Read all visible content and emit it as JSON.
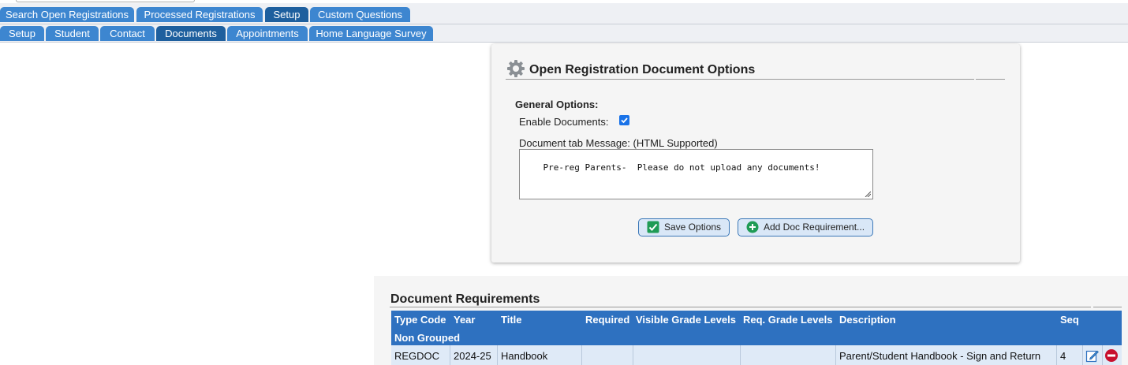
{
  "tabs_top": [
    "Search Open Registrations",
    "Processed Registrations",
    "Setup",
    "Custom Questions"
  ],
  "tabs_sub": [
    "Setup",
    "Student",
    "Contact",
    "Documents",
    "Appointments",
    "Home Language Survey"
  ],
  "panel": {
    "title": "Open Registration Document Options",
    "general_options": "General Options:",
    "enable_documents_label": "Enable Documents:",
    "enable_documents_checked": true,
    "message_label": "Document tab Message: (HTML Supported)",
    "message_value": "Pre-reg Parents-  Please do not upload any documents!",
    "save_button": "Save Options",
    "add_button": "Add Doc Requirement..."
  },
  "requirements": {
    "title": "Document Requirements",
    "columns": [
      "Type Code",
      "Year",
      "Title",
      "Required",
      "Visible Grade Levels",
      "Req. Grade Levels",
      "Description",
      "Seq"
    ],
    "group_label": "Non Grouped",
    "rows": [
      {
        "type_code": "REGDOC",
        "year": "2024-25",
        "title": "Handbook",
        "required": "",
        "visible_grade_levels": "",
        "req_grade_levels": "",
        "description": "Parent/Student Handbook - Sign and Return",
        "seq": "4"
      }
    ]
  },
  "colors": {
    "tab": "#3d86d0",
    "tab_active": "#1e5f9e",
    "table_header": "#2e71c0",
    "row_bg": "#dfeaf7",
    "button_bg": "#d9e7f7"
  },
  "icons": [
    "gear-icon",
    "checkmark-icon",
    "add-circle-icon",
    "edit-icon",
    "delete-icon",
    "resize-grip-icon"
  ]
}
